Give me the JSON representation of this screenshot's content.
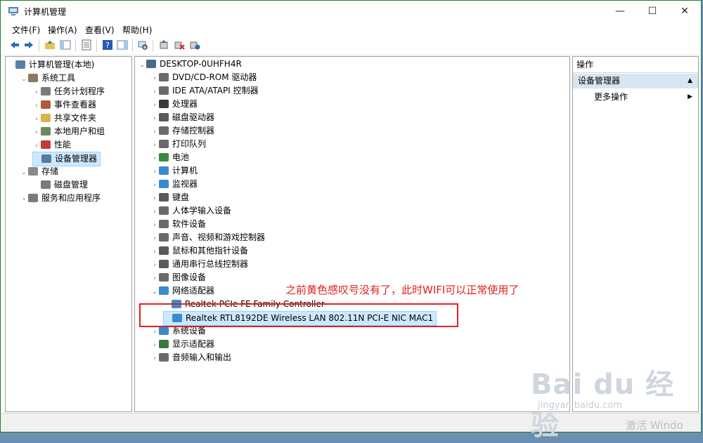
{
  "window": {
    "title": "计算机管理",
    "min": "—",
    "max": "☐",
    "close": "✕"
  },
  "menu": [
    "文件(F)",
    "操作(A)",
    "查看(V)",
    "帮助(H)"
  ],
  "left_tree": [
    {
      "label": "计算机管理(本地)",
      "depth": 0,
      "arrow": "",
      "icon": "computer-management-icon",
      "color": "#5a7fa8"
    },
    {
      "label": "系统工具",
      "depth": 1,
      "arrow": "⌄",
      "icon": "tools-icon",
      "color": "#8a7a5a"
    },
    {
      "label": "任务计划程序",
      "depth": 2,
      "arrow": "›",
      "icon": "task-scheduler-icon",
      "color": "#7a7a7a"
    },
    {
      "label": "事件查看器",
      "depth": 2,
      "arrow": "›",
      "icon": "event-viewer-icon",
      "color": "#b05a3a"
    },
    {
      "label": "共享文件夹",
      "depth": 2,
      "arrow": "›",
      "icon": "shared-folder-icon",
      "color": "#d9b24a"
    },
    {
      "label": "本地用户和组",
      "depth": 2,
      "arrow": "›",
      "icon": "users-icon",
      "color": "#6a8a5a"
    },
    {
      "label": "性能",
      "depth": 2,
      "arrow": "›",
      "icon": "performance-icon",
      "color": "#c43a3a"
    },
    {
      "label": "设备管理器",
      "depth": 2,
      "arrow": "",
      "icon": "device-manager-icon",
      "color": "#5a7a9a",
      "selected": true
    },
    {
      "label": "存储",
      "depth": 1,
      "arrow": "⌄",
      "icon": "storage-icon",
      "color": "#8a8a8a"
    },
    {
      "label": "磁盘管理",
      "depth": 2,
      "arrow": "",
      "icon": "disk-icon",
      "color": "#7a7a7a"
    },
    {
      "label": "服务和应用程序",
      "depth": 1,
      "arrow": "›",
      "icon": "services-icon",
      "color": "#7a7a7a"
    }
  ],
  "device_tree": [
    {
      "label": "DESKTOP-0UHFH4R",
      "depth": 0,
      "arrow": "⌄",
      "icon": "computer-icon",
      "color": "#4a6a8a"
    },
    {
      "label": "DVD/CD-ROM 驱动器",
      "depth": 1,
      "arrow": "›",
      "icon": "dvd-icon",
      "color": "#6a6a6a"
    },
    {
      "label": "IDE ATA/ATAPI 控制器",
      "depth": 1,
      "arrow": "›",
      "icon": "ide-controller-icon",
      "color": "#6a6a6a"
    },
    {
      "label": "处理器",
      "depth": 1,
      "arrow": "›",
      "icon": "processor-icon",
      "color": "#3a3a3a"
    },
    {
      "label": "磁盘驱动器",
      "depth": 1,
      "arrow": "›",
      "icon": "disk-drive-icon",
      "color": "#5a5a5a"
    },
    {
      "label": "存储控制器",
      "depth": 1,
      "arrow": "›",
      "icon": "storage-controller-icon",
      "color": "#6a6a6a"
    },
    {
      "label": "打印队列",
      "depth": 1,
      "arrow": "›",
      "icon": "printer-icon",
      "color": "#6a6a6a"
    },
    {
      "label": "电池",
      "depth": 1,
      "arrow": "›",
      "icon": "battery-icon",
      "color": "#3a8a3a"
    },
    {
      "label": "计算机",
      "depth": 1,
      "arrow": "›",
      "icon": "monitor-icon",
      "color": "#3a8ad0"
    },
    {
      "label": "监视器",
      "depth": 1,
      "arrow": "›",
      "icon": "display-icon",
      "color": "#3a8ad0"
    },
    {
      "label": "键盘",
      "depth": 1,
      "arrow": "›",
      "icon": "keyboard-icon",
      "color": "#5a5a5a"
    },
    {
      "label": "人体学输入设备",
      "depth": 1,
      "arrow": "›",
      "icon": "hid-icon",
      "color": "#6a6a6a"
    },
    {
      "label": "软件设备",
      "depth": 1,
      "arrow": "›",
      "icon": "software-device-icon",
      "color": "#6a6a6a"
    },
    {
      "label": "声音、视频和游戏控制器",
      "depth": 1,
      "arrow": "›",
      "icon": "speaker-icon",
      "color": "#6a6a6a"
    },
    {
      "label": "鼠标和其他指针设备",
      "depth": 1,
      "arrow": "›",
      "icon": "mouse-icon",
      "color": "#5a5a5a"
    },
    {
      "label": "通用串行总线控制器",
      "depth": 1,
      "arrow": "›",
      "icon": "usb-icon",
      "color": "#5a5a5a"
    },
    {
      "label": "图像设备",
      "depth": 1,
      "arrow": "›",
      "icon": "camera-icon",
      "color": "#6a6a6a"
    },
    {
      "label": "网络适配器",
      "depth": 1,
      "arrow": "⌄",
      "icon": "network-adapter-icon",
      "color": "#3a8ad0"
    },
    {
      "label": "Realtek PCIe FE Family Controller",
      "depth": 2,
      "arrow": "",
      "icon": "network-card-icon",
      "color": "#3a8ad0"
    },
    {
      "label": "Realtek RTL8192DE Wireless LAN 802.11N PCI-E NIC MAC1",
      "depth": 2,
      "arrow": "",
      "icon": "wireless-card-icon",
      "color": "#3a8ad0",
      "selected": true
    },
    {
      "label": "系统设备",
      "depth": 1,
      "arrow": "›",
      "icon": "system-device-icon",
      "color": "#3a8ad0"
    },
    {
      "label": "显示适配器",
      "depth": 1,
      "arrow": "›",
      "icon": "display-adapter-icon",
      "color": "#3a7a3a"
    },
    {
      "label": "音频输入和输出",
      "depth": 1,
      "arrow": "›",
      "icon": "audio-icon",
      "color": "#6a6a6a"
    }
  ],
  "actions": {
    "header": "操作",
    "section": "设备管理器",
    "more": "更多操作"
  },
  "annotation": "之前黄色感叹号没有了，此时WIFI可以正常使用了",
  "watermarks": {
    "baidu": "Bai du 经验",
    "url": "jingyan.baidu.com",
    "activate": "激活 Windo"
  }
}
